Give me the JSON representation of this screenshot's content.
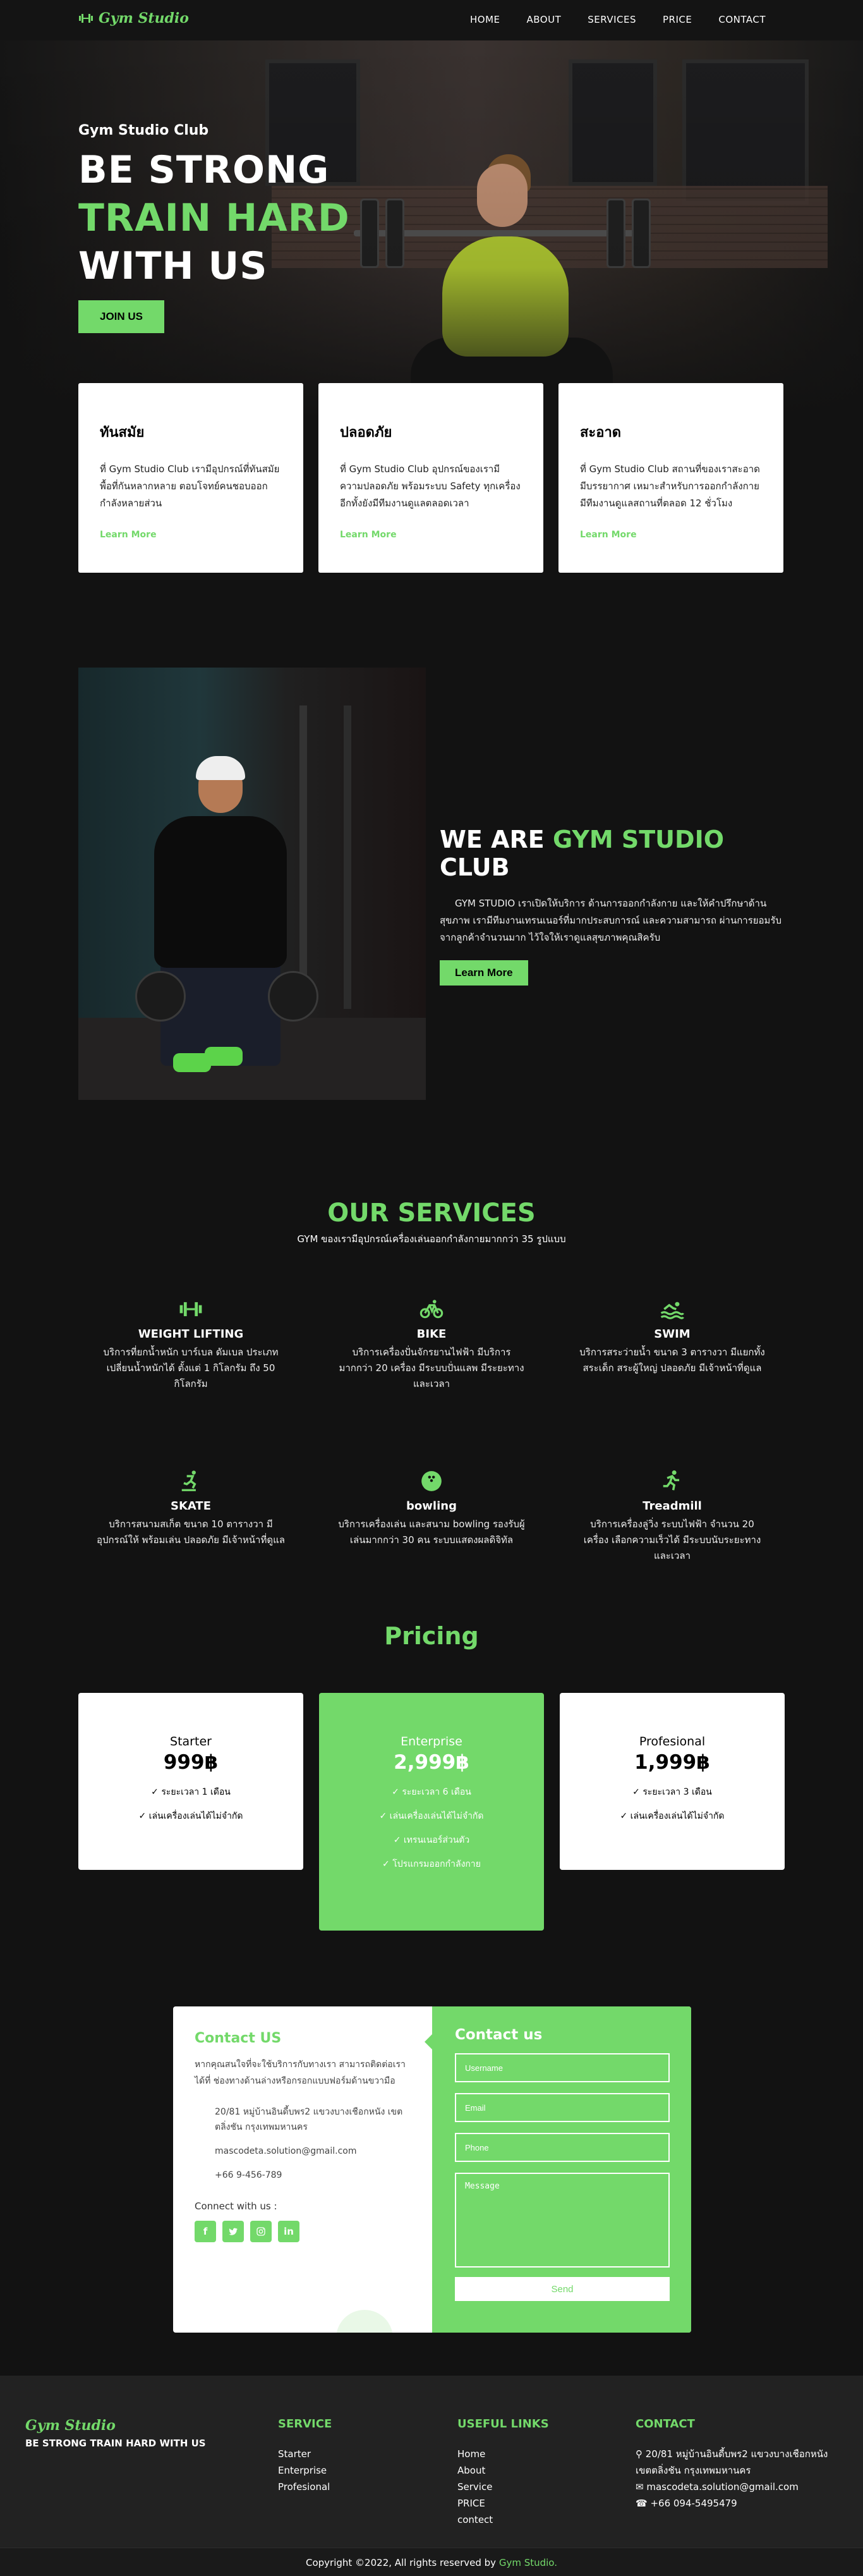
{
  "nav": {
    "brand": "Gym Studio",
    "links": [
      "HOME",
      "ABOUT",
      "SERVICES",
      "PRICE",
      "CONTACT"
    ]
  },
  "hero": {
    "kicker": "Gym Studio Club",
    "line1": "BE STRONG",
    "line2": "TRAIN HARD",
    "line3": "WITH US",
    "cta": "JOIN US"
  },
  "features": [
    {
      "title": "ทันสมัย",
      "text": "ที่ Gym Studio Club เรามีอุปกรณ์ที่ทันสมัย พื้อที่กันหลากหลาย ตอบโจทย์คนชอบออกกำลังหลายส่วน",
      "link": "Learn More"
    },
    {
      "title": "ปลอดภัย",
      "text": "ที่ Gym Studio Club อุปกรณ์ของเรามีความปลอดภัย พร้อมระบบ Safety ทุกเครื่อง อีกทั้งยังมีทีมงานดูแลตลอดเวลา",
      "link": "Learn More"
    },
    {
      "title": "สะอาด",
      "text": "ที่ Gym Studio Club สถานที่ของเราสะอาด มีบรรยากาศ เหมาะสำหรับการออกกำลังกาย มีทีมงานดูแลสถานที่ตลอด 12 ชั่วโมง",
      "link": "Learn More"
    }
  ],
  "about": {
    "title_pre": "WE ARE",
    "title_accent": "GYM STUDIO",
    "title_post": "CLUB",
    "desc": "GYM STUDIO เราเปิดให้บริการ ด้านการออกกำลังกาย และให้คำปรึกษาด้านสุขภาพ เรามีทีมงานเทรนเนอร์ที่มากประสบการณ์ และความสามารถ ผ่านการยอมรับจากลูกค้าจำนวนมาก ไว้ใจให้เราดูแลสุขภาพคุณสิครับ",
    "cta": "Learn More"
  },
  "services": {
    "title": "OUR SERVICES",
    "subtitle": "GYM ของเรามีอุปกรณ์เครื่องเล่นออกกำลังกายมากกว่า 35 รูปแบบ",
    "items": [
      {
        "icon": "dumbbell-icon",
        "title": "WEIGHT LIFTING",
        "text": "บริการที่ยกน้ำหนัก บาร์เบล ดัมเบล ประเภทเปลี่ยนน้ำหนักได้ ตั้งแต่ 1 กิโลกรัม ถึง 50 กิโลกรัม"
      },
      {
        "icon": "bicycle-icon",
        "title": "BIKE",
        "text": "บริการเครื่องปั่นจักรยานไฟฟ้า มีบริการมากกว่า 20 เครื่อง มีระบบปั่นแลพ มีระยะทาง และเวลา"
      },
      {
        "icon": "swimmer-icon",
        "title": "SWIM",
        "text": "บริการสระว่ายน้ำ ขนาด 3 ตารางวา มีแยกทั้งสระเด็ก สระผู้ใหญ่ ปลอดภัย มีเจ้าหน้าที่ดูแล"
      },
      {
        "icon": "skater-icon",
        "title": "SKATE",
        "text": "บริการสนามสเก็ต ขนาด 10 ตารางวา มีอุปกรณ์ให้ พร้อมเล่น ปลอดภัย มีเจ้าหน้าที่ดูแล"
      },
      {
        "icon": "bowling-ball-icon",
        "title": "bowling",
        "text": "บริการเครื่องเล่น และสนาม bowling รองรับผู้เล่นมากกว่า 30 คน ระบบแสดงผลดิจิทัล"
      },
      {
        "icon": "runner-icon",
        "title": "Treadmill",
        "text": "บริการเครื่องลู่วิ่ง ระบบไฟฟ้า จำนวน 20 เครื่อง เลือกความเร็วได้ มีระบบนับระยะทาง และเวลา"
      }
    ]
  },
  "pricing": {
    "title": "Pricing",
    "plans": [
      {
        "name": "Starter",
        "price": "999฿",
        "features": [
          "✓ ระยะเวลา 1 เดือน",
          "✓ เล่นเครื่องเล่นได้ไม่จำกัด"
        ]
      },
      {
        "name": "Enterprise",
        "price": "2,999฿",
        "features": [
          "✓ ระยะเวลา 6 เดือน",
          "✓ เล่นเครื่องเล่นได้ไม่จำกัด",
          "✓ เทรนเนอร์ส่วนตัว",
          "✓ โปรแกรมออกกำลังกาย"
        ]
      },
      {
        "name": "Profesional",
        "price": "1,999฿",
        "features": [
          "✓ ระยะเวลา 3 เดือน",
          "✓ เล่นเครื่องเล่นได้ไม่จำกัด"
        ]
      }
    ]
  },
  "contact": {
    "title": "Contact US",
    "desc": "หากคุณสนใจที่จะใช้บริการกับทางเรา สามารถติดต่อเราได้ที่ ช่องทางด้านล่างหรือกรอกแบบฟอร์มด้านขวามือ",
    "address": "20/81 หมู่บ้านอินดี้บพร2 แขวงบางเชือกหนัง เขตตลิ่งชัน กรุงเทพมหานคร",
    "email": "mascodeta.solution@gmail.com",
    "phone": "+66 9-456-789",
    "connect": "Connect with us :",
    "form_title": "Contact us",
    "username_ph": "Username",
    "email_ph": "Email",
    "phone_ph": "Phone",
    "message_ph": "Message",
    "send": "Send"
  },
  "footer": {
    "brand": "Gym Studio",
    "slogan": "BE STRONG TRAIN HARD WITH US",
    "service_title": "SERVICE",
    "service_items": [
      "Starter",
      "Enterprise",
      "Profesional"
    ],
    "links_title": "USEFUL LINKS",
    "links_items": [
      "Home",
      "About",
      "Service",
      "PRICE",
      "contect"
    ],
    "contact_title": "CONTACT",
    "address": "20/81 หมู่บ้านอินดี้บพร2 แขวงบางเชือกหนัง เขตตลิ่งชัน กรุงเทพมหานคร",
    "email": "mascodeta.solution@gmail.com",
    "phone": "+66 094-5495479",
    "copyright": "Copyright ©2022, All rights reserved by",
    "copyright_brand": "Gym Studio."
  },
  "colors": {
    "accent": "#73d96a",
    "background": "#121212",
    "footer": "#222222"
  }
}
